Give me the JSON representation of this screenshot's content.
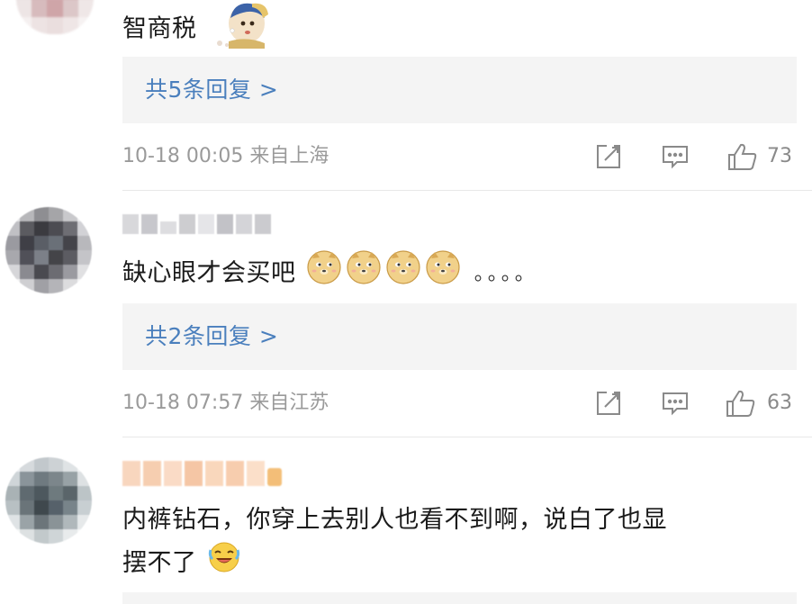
{
  "comments": [
    {
      "text": "智商税",
      "reply_link": "共5条回复 >",
      "meta": "10-18 00:05 来自上海",
      "likes": "73"
    },
    {
      "text": "缺心眼才会买吧",
      "trailing": "。。。。",
      "reply_link": "共2条回复 >",
      "meta": "10-18 07:57 来自江苏",
      "likes": "63"
    },
    {
      "text_line1": "内裤钻石，你穿上去别人也看不到啊，说白了也显",
      "text_line2": "摆不了"
    }
  ],
  "icons": {
    "share": "share-icon",
    "comment": "comment-icon",
    "like": "thumbs-up-icon",
    "emoji_girl": "girl-with-pearl-earring-emoji",
    "emoji_doge": "doge-emoji",
    "emoji_laugh": "laugh-cry-emoji"
  },
  "colors": {
    "link": "#4a7fbd",
    "meta": "#9a9a9a",
    "reply_bg": "#f4f4f4"
  }
}
